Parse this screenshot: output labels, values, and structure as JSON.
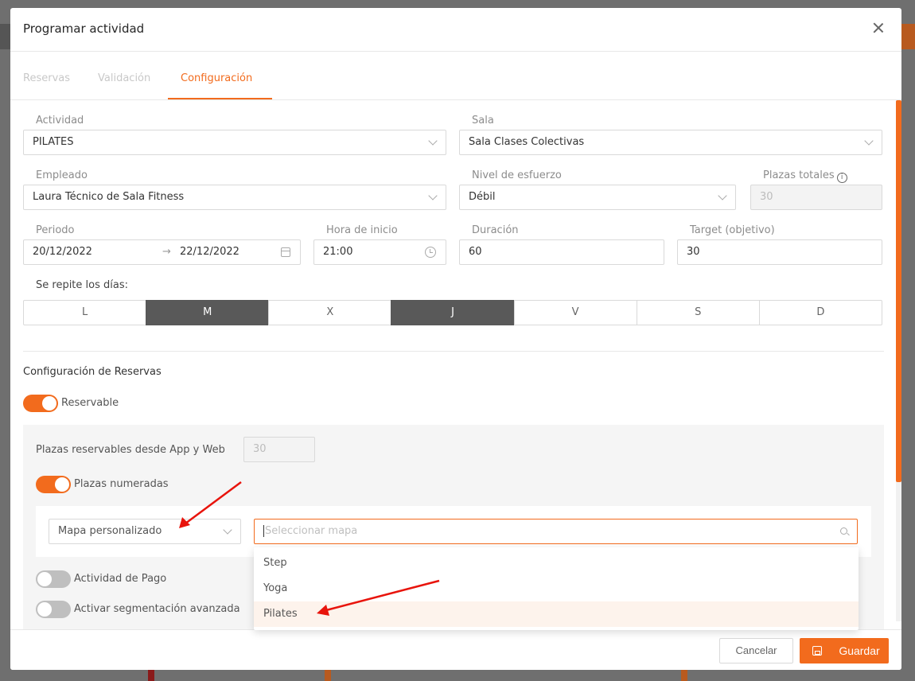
{
  "modal": {
    "title": "Programar actividad"
  },
  "tabs": [
    {
      "label": "Reservas"
    },
    {
      "label": "Validación"
    },
    {
      "label": "Configuración"
    }
  ],
  "form": {
    "actividad": {
      "label": "Actividad",
      "value": "PILATES"
    },
    "sala": {
      "label": "Sala",
      "value": "Sala Clases Colectivas"
    },
    "empleado": {
      "label": "Empleado",
      "value": "Laura Técnico de Sala Fitness"
    },
    "nivel": {
      "label": "Nivel de esfuerzo",
      "value": "Débil"
    },
    "plazas_totales": {
      "label": "Plazas totales",
      "value": "30"
    },
    "periodo": {
      "label": "Periodo",
      "start": "20/12/2022",
      "end": "22/12/2022"
    },
    "hora": {
      "label": "Hora de inicio",
      "value": "21:00"
    },
    "duracion": {
      "label": "Duración",
      "value": "60"
    },
    "target": {
      "label": "Target (objetivo)",
      "value": "30"
    },
    "repeat_label": "Se repite los días:",
    "days": [
      {
        "label": "L",
        "selected": false
      },
      {
        "label": "M",
        "selected": true
      },
      {
        "label": "X",
        "selected": false
      },
      {
        "label": "J",
        "selected": true
      },
      {
        "label": "V",
        "selected": false
      },
      {
        "label": "S",
        "selected": false
      },
      {
        "label": "D",
        "selected": false
      }
    ]
  },
  "reservas": {
    "title": "Configuración de Reservas",
    "reservable": {
      "label": "Reservable",
      "on": true
    },
    "plazas_reservables": {
      "label": "Plazas reservables desde App y Web",
      "value": "30"
    },
    "plazas_numeradas": {
      "label": "Plazas numeradas",
      "on": true
    },
    "mapa_tipo": "Mapa personalizado",
    "mapa_placeholder": "Seleccionar mapa",
    "mapa_options": [
      "Step",
      "Yoga",
      "Pilates"
    ],
    "actividad_pago": {
      "label": "Actividad de Pago",
      "on": false
    },
    "segmentacion": {
      "label": "Activar segmentación avanzada",
      "on": false
    }
  },
  "footer": {
    "cancel": "Cancelar",
    "save": "Guardar"
  },
  "colors": {
    "accent": "#f26b1d",
    "selected_day": "#595959",
    "annotation_arrow": "#e8140c"
  }
}
